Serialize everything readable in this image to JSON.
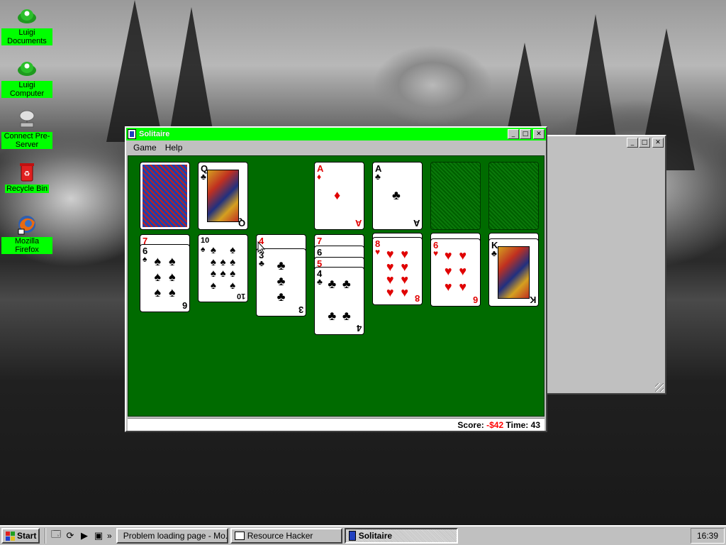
{
  "desktop": {
    "icons": [
      {
        "label": "Luigi Documents",
        "icon": "luigi-hat-icon"
      },
      {
        "label": "Luigi Computer",
        "icon": "luigi-hat-icon"
      },
      {
        "label": "Connect Pre-Server",
        "icon": "network-drive-icon"
      },
      {
        "label": "Recycle Bin",
        "icon": "recycle-bin-icon"
      },
      {
        "label": "Mozilla Firefox",
        "icon": "firefox-icon"
      }
    ]
  },
  "solitaire": {
    "title": "Solitaire",
    "menu": {
      "game": "Game",
      "help": "Help"
    },
    "status": {
      "score_label": "Score:",
      "score_value": "-$42",
      "time_label": "Time:",
      "time_value": "43"
    },
    "waste_top": {
      "rank": "Q",
      "suit": "♣"
    },
    "foundations": [
      {
        "rank": "A",
        "suit": "♦",
        "color": "red"
      },
      {
        "rank": "A",
        "suit": "♣",
        "color": "black"
      },
      null,
      null
    ],
    "tableau": [
      {
        "hidden_rank": "7",
        "top": {
          "rank": "6",
          "suit": "♠"
        }
      },
      {
        "top": {
          "rank": "10",
          "suit": "♠"
        }
      },
      {
        "hidden_rank": "4",
        "top": {
          "rank": "3",
          "suit": "♣"
        }
      },
      {
        "fanned": [
          "7",
          "6",
          "5"
        ],
        "top": {
          "rank": "4",
          "suit": "♣"
        }
      },
      {
        "top": {
          "rank": "8",
          "suit": "♥"
        }
      },
      {
        "top": {
          "rank": "6",
          "suit": "♥"
        }
      },
      {
        "top": {
          "rank": "K",
          "suit": "♣"
        }
      }
    ]
  },
  "taskbar": {
    "start": "Start",
    "tasks": [
      "Problem loading page - Mo...",
      "Resource Hacker",
      "Solitaire"
    ],
    "clock": "16:39",
    "overflow": "»"
  }
}
